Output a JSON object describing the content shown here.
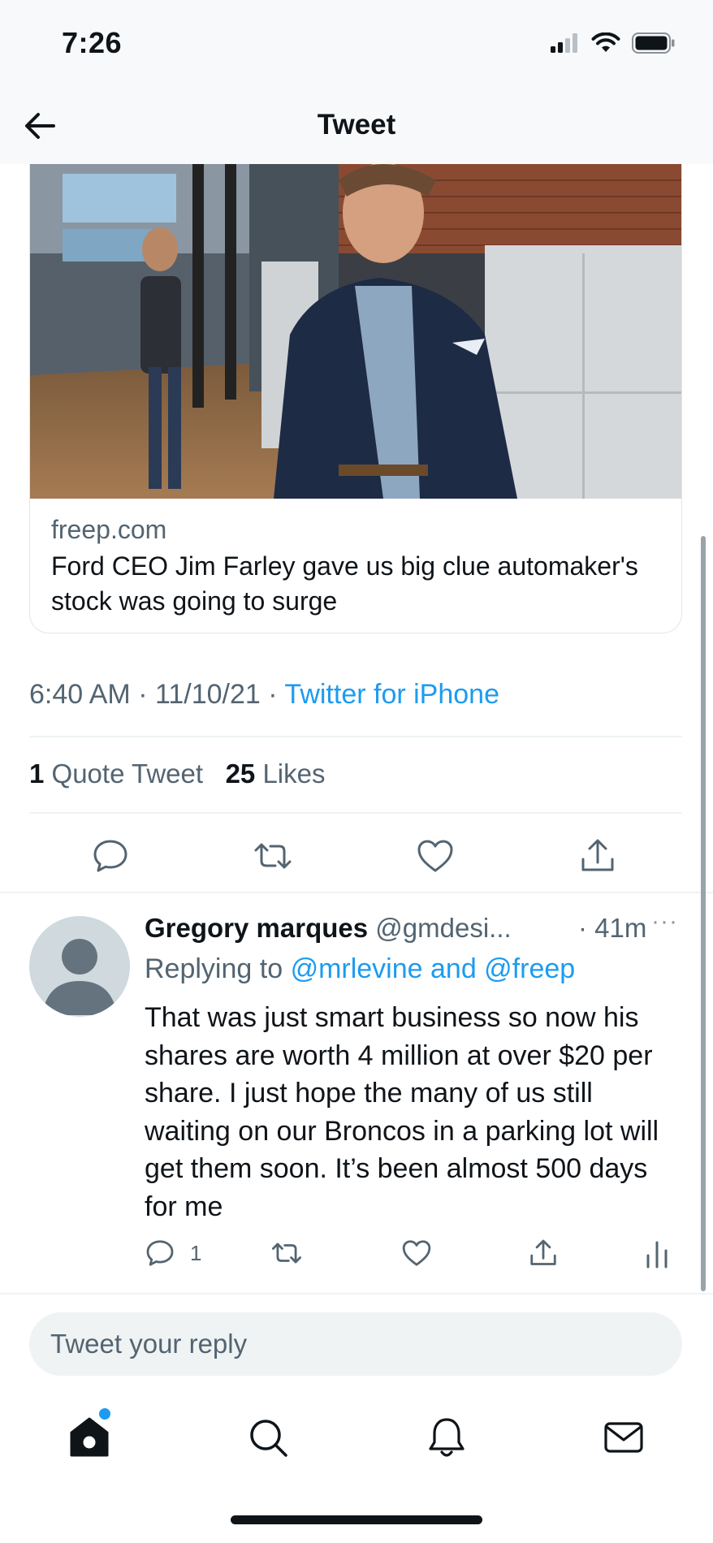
{
  "status_bar": {
    "time": "7:26"
  },
  "header": {
    "title": "Tweet"
  },
  "link_card": {
    "domain": "freep.com",
    "title": "Ford CEO Jim Farley gave us big clue automaker's stock was going to surge"
  },
  "tweet_meta": {
    "time": "6:40 AM",
    "date": "11/10/21",
    "source": "Twitter for iPhone"
  },
  "stats": {
    "quote_count": "1",
    "quote_label": "Quote Tweet",
    "likes_count": "25",
    "likes_label": "Likes"
  },
  "reply": {
    "name": "Gregory marques",
    "handle": "@gmdesi...",
    "time": "· 41m",
    "more": "···",
    "replying_prefix": "Replying to",
    "replying_mentions": "@mrlevine and @freep",
    "text": "That was just smart business so now his shares are worth 4 million at over $20 per share. I just hope the many of us still waiting on our Broncos in a parking lot will get them soon. It’s been almost 500 days for me",
    "reply_count": "1"
  },
  "composer": {
    "placeholder": "Tweet your reply"
  },
  "icons": {
    "back": "arrow-left-icon",
    "reply": "comment-icon",
    "retweet": "retweet-icon",
    "like": "heart-icon",
    "share": "share-icon",
    "analytics": "analytics-icon",
    "home": "home-icon",
    "search": "search-icon",
    "notifications": "bell-icon",
    "messages": "mail-icon"
  },
  "colors": {
    "accent": "#1d9bf0",
    "text_primary": "#0f1419",
    "text_secondary": "#536471"
  }
}
